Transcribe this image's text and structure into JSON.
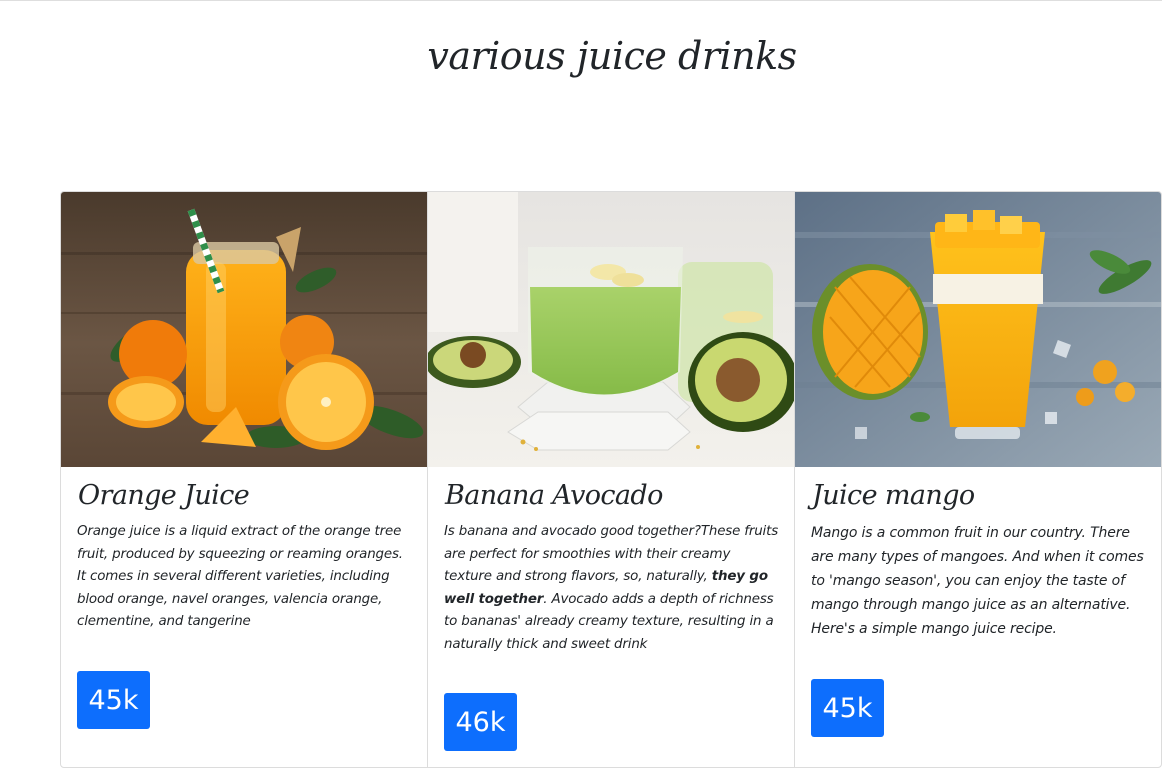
{
  "page": {
    "title": "various juice drinks"
  },
  "cards": [
    {
      "title": "Orange Juice",
      "text_parts": [
        "Orange juice is a liquid extract of the orange tree fruit, produced by squeezing or reaming oranges. It comes in several different varieties, including blood orange, navel oranges, valencia orange, clementine, and tangerine"
      ],
      "count": "45k",
      "image_icon": "orange-juice-photo"
    },
    {
      "title": "Banana Avocado",
      "text_parts": [
        "Is banana and avocado good together?These fruits are perfect for smoothies with their creamy texture and strong flavors, so, naturally, ",
        "they go well together",
        ". Avocado adds a depth of richness to bananas' already creamy texture, resulting in a naturally thick and sweet drink"
      ],
      "count": "46k",
      "image_icon": "banana-avocado-smoothie-photo"
    },
    {
      "title": "Juice mango",
      "text_parts": [
        "Mango is a common fruit in our country. There are many types of mangoes. And when it comes to 'mango season', you can enjoy the taste of mango through mango juice as an alternative. Here's a simple mango juice recipe."
      ],
      "count": "45k",
      "image_icon": "mango-juice-photo"
    }
  ]
}
